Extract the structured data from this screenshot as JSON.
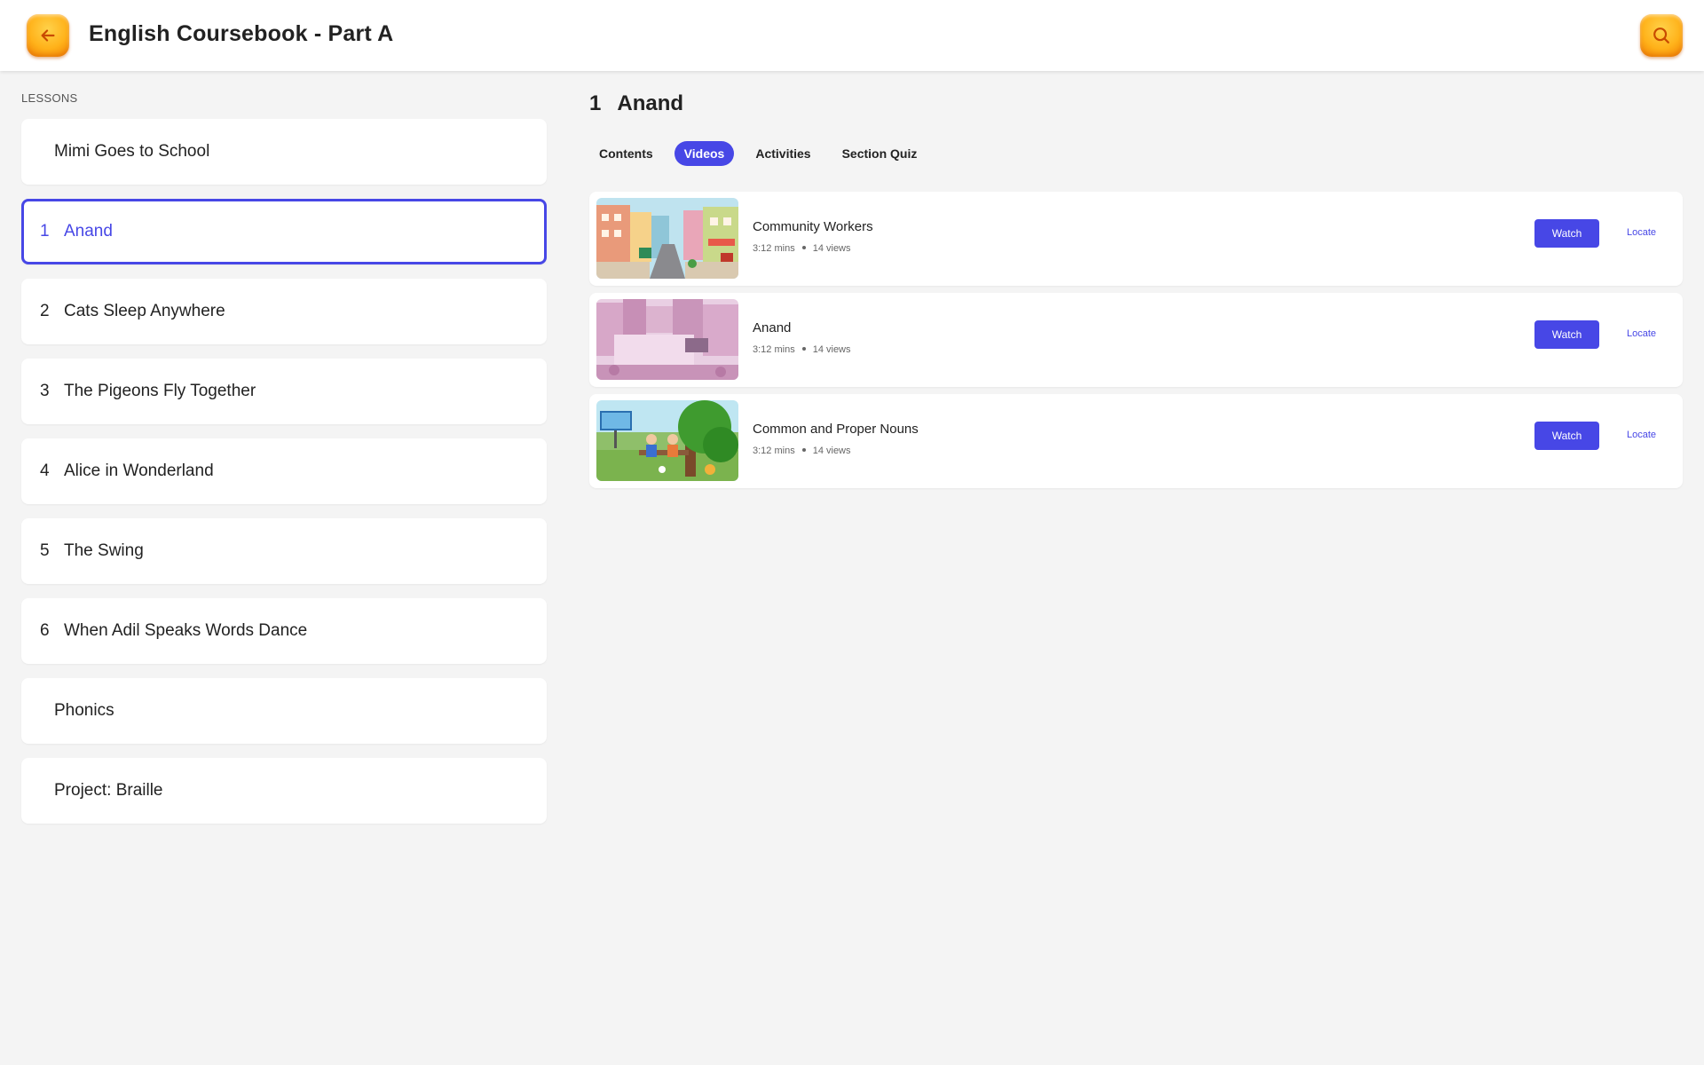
{
  "header": {
    "title": "English Coursebook - Part A",
    "back_icon": "arrow-left-icon",
    "search_icon": "search-icon"
  },
  "sidebar": {
    "heading": "LESSONS",
    "items": [
      {
        "num": "",
        "label": "Mimi Goes to School",
        "active": false
      },
      {
        "num": "1",
        "label": "Anand",
        "active": true
      },
      {
        "num": "2",
        "label": "Cats Sleep Anywhere",
        "active": false
      },
      {
        "num": "3",
        "label": "The Pigeons Fly Together",
        "active": false
      },
      {
        "num": "4",
        "label": "Alice in Wonderland",
        "active": false
      },
      {
        "num": "5",
        "label": "The Swing",
        "active": false
      },
      {
        "num": "6",
        "label": "When Adil Speaks Words Dance",
        "active": false
      },
      {
        "num": "",
        "label": "Phonics",
        "active": false
      },
      {
        "num": "",
        "label": "Project: Braille",
        "active": false
      }
    ]
  },
  "main": {
    "section_num": "1",
    "section_title": "Anand",
    "tabs": [
      {
        "label": "Contents",
        "active": false
      },
      {
        "label": "Videos",
        "active": true
      },
      {
        "label": "Activities",
        "active": false
      },
      {
        "label": "Section Quiz",
        "active": false
      }
    ],
    "videos": [
      {
        "title": "Community Workers",
        "duration": "3:12 mins",
        "views": "14 views",
        "watch_label": "Watch",
        "locate_label": "Locate"
      },
      {
        "title": "Anand",
        "duration": "3:12 mins",
        "views": "14 views",
        "watch_label": "Watch",
        "locate_label": "Locate"
      },
      {
        "title": "Common and Proper Nouns",
        "duration": "3:12 mins",
        "views": "14 views",
        "watch_label": "Watch",
        "locate_label": "Locate"
      }
    ]
  },
  "colors": {
    "accent": "#4747e6",
    "header_button": "#ffb21a",
    "background": "#f4f4f4"
  }
}
